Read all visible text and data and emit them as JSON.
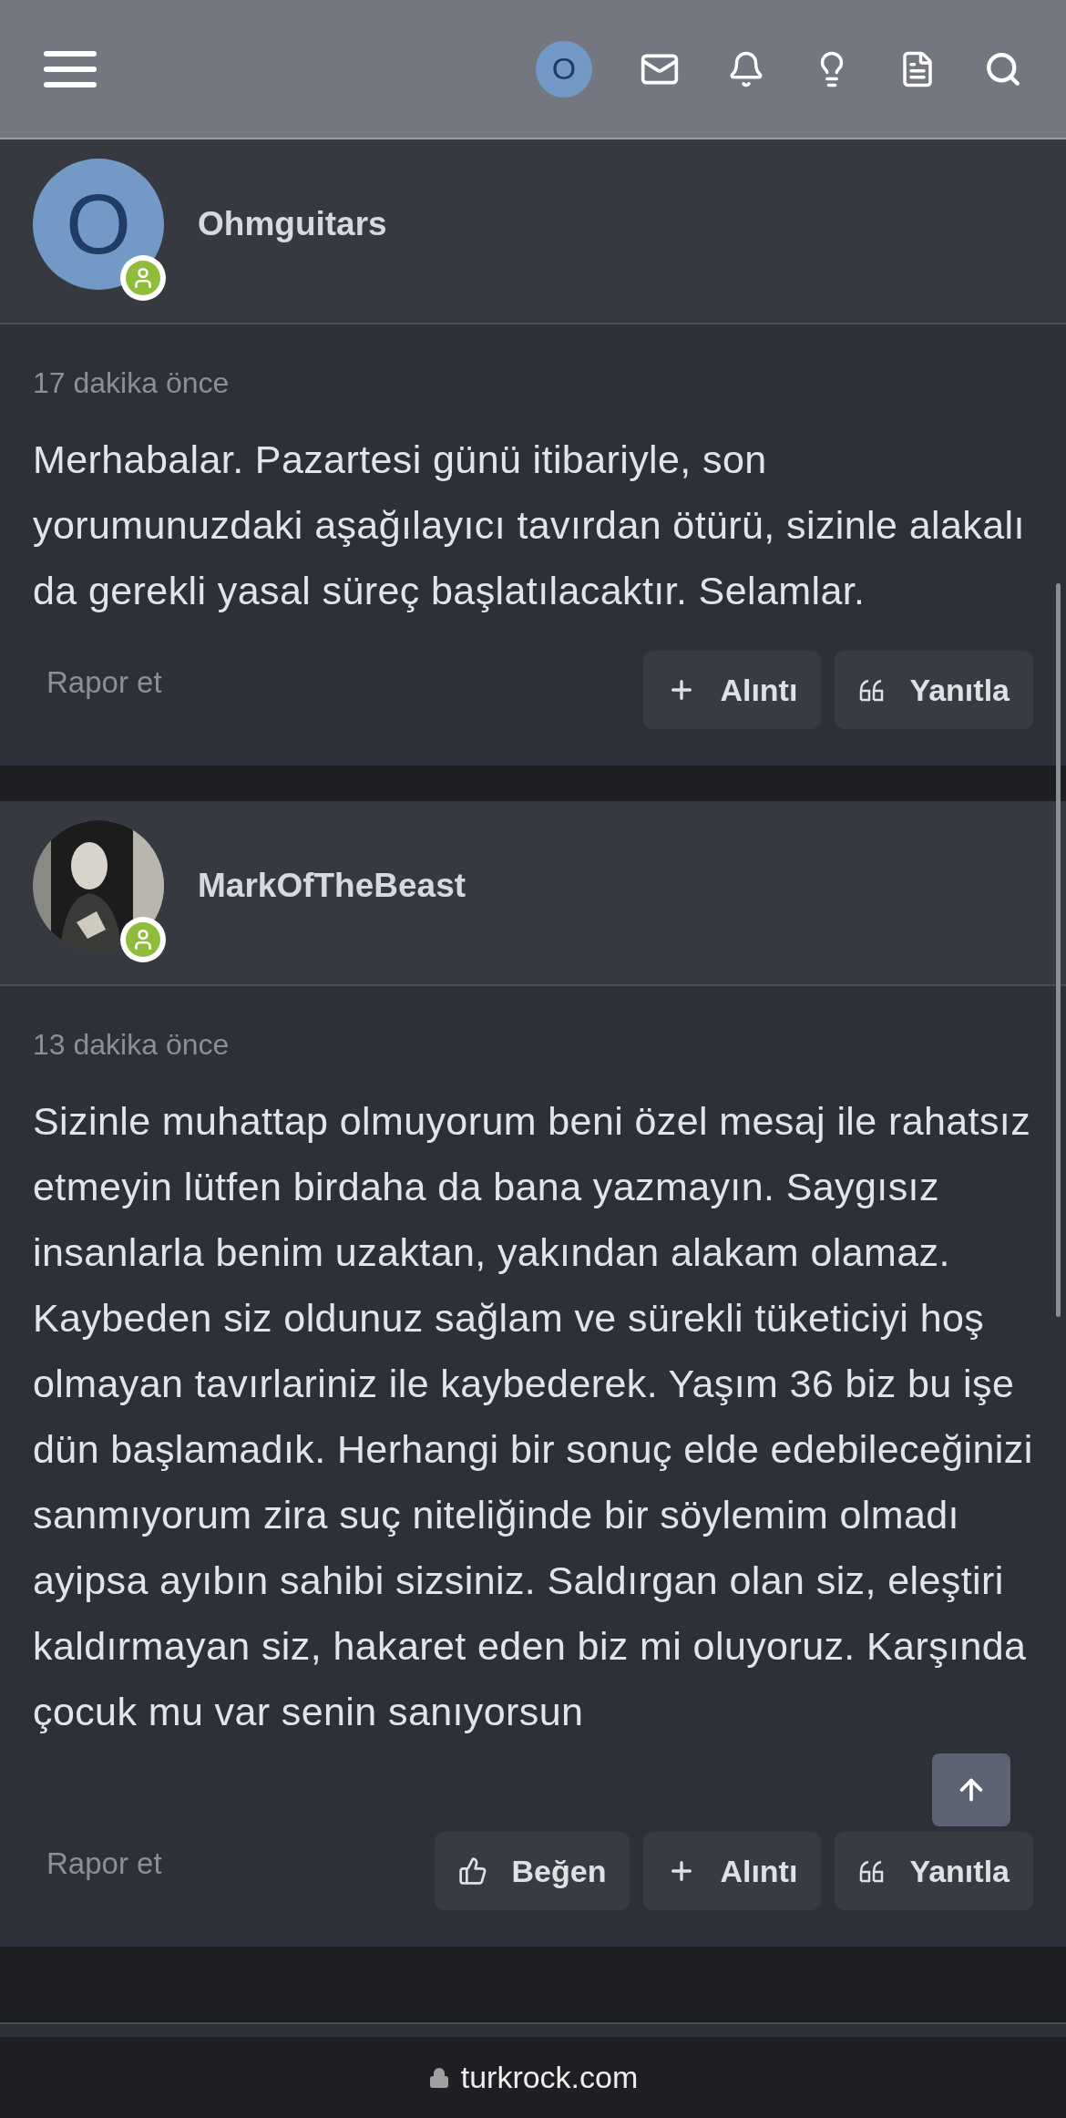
{
  "header": {
    "user_initial": "O"
  },
  "posts": [
    {
      "author": "Ohmguitars",
      "avatar": {
        "kind": "letter",
        "letter": "O"
      },
      "online": true,
      "time": "17 dakika önce",
      "body": "Merhabalar. Pazartesi günü itibariyle, son yorumunuzdaki aşağılayıcı tavırdan ötürü, sizinle alakalı da gerekli yasal süreç başlatılacaktır. Selamlar.",
      "report": "Rapor et",
      "actions": [
        {
          "kind": "quote",
          "label": "Alıntı"
        },
        {
          "kind": "reply",
          "label": "Yanıtla"
        }
      ]
    },
    {
      "author": "MarkOfTheBeast",
      "online": true,
      "time": "13 dakika önce",
      "body": "Sizinle muhattap olmuyorum beni özel mesaj ile rahatsız etmeyin lütfen birdaha da bana yazmayın. Saygısız insanlarla benim uzaktan, yakından alakam olamaz. Kaybeden siz oldunuz sağlam ve sürekli tüketiciyi hoş olmayan tavırlariniz ile kaybederek. Yaşım 36 biz bu işe dün başlamadık. Herhangi bir sonuç elde edebileceğinizi sanmıyorum zira suç niteliğinde bir söylemim olmadı ayipsa ayıbın sahibi sizsiniz. Saldırgan olan siz, eleştiri kaldırmayan siz, hakaret eden biz mi oluyoruz. Karşında çocuk mu var senin sanıyorsun",
      "report": "Rapor et",
      "actions": [
        {
          "kind": "like",
          "label": "Beğen"
        },
        {
          "kind": "quote",
          "label": "Alıntı"
        },
        {
          "kind": "reply",
          "label": "Yanıtla"
        }
      ]
    }
  ],
  "url_bar": {
    "domain": "turkrock.com"
  }
}
